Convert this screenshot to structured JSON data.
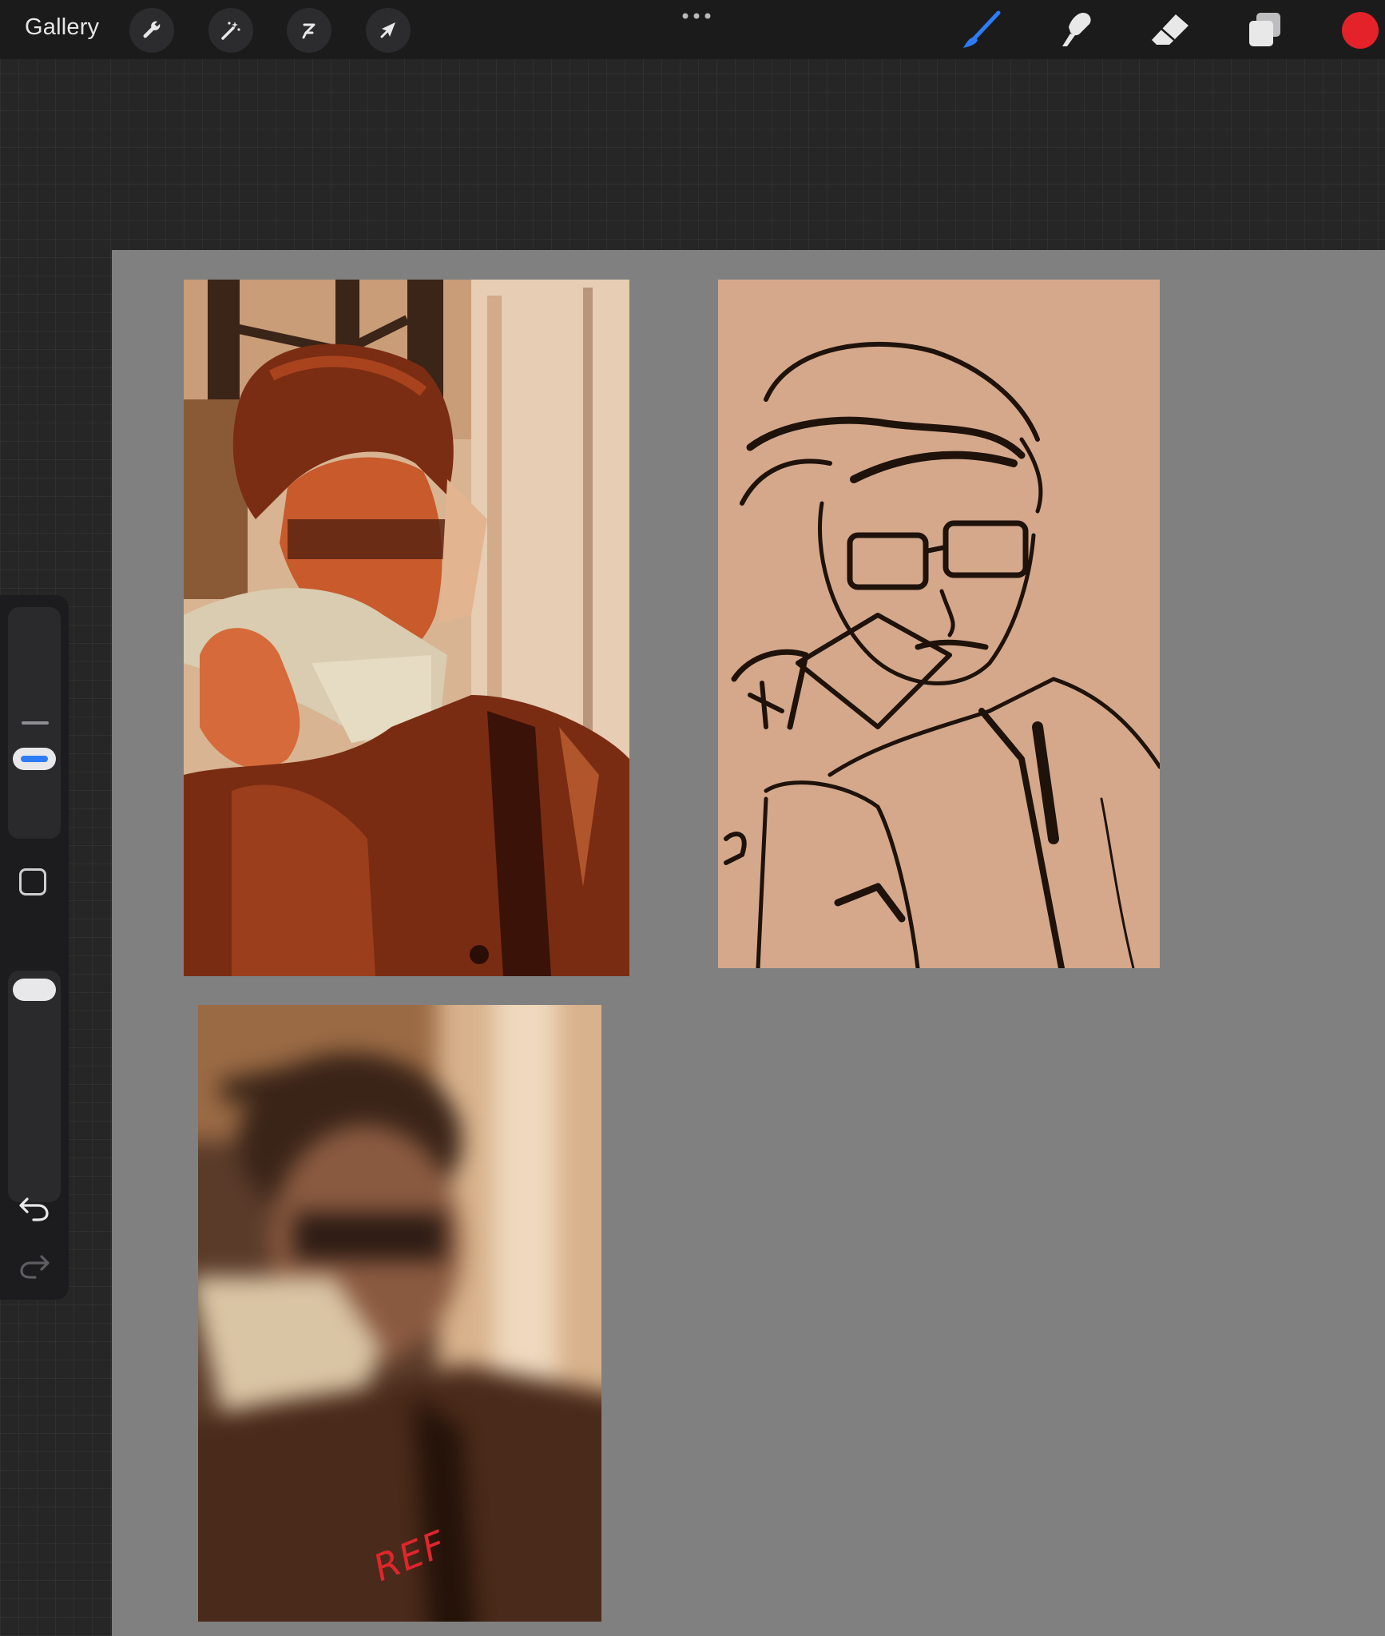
{
  "topbar": {
    "gallery_label": "Gallery",
    "left_tools": [
      "wrench-icon",
      "magic-wand-icon",
      "selection-icon",
      "transform-arrow-icon"
    ],
    "right_tools": [
      "brush-icon",
      "smudge-icon",
      "eraser-icon",
      "layers-icon"
    ],
    "active_tool": "brush",
    "current_color": "#e3222a",
    "accent_color": "#2d7cf6"
  },
  "canvas": {
    "background": "#808080",
    "artworks": [
      {
        "name": "painted-study",
        "description_colors": [
          "#7a2a12",
          "#c4572b",
          "#e0cdb4"
        ]
      },
      {
        "name": "line-sketch",
        "paper": "#d5a88b",
        "ink": "#1e120b"
      },
      {
        "name": "blurred-reference"
      }
    ],
    "ref_label": "REF"
  },
  "sidebar": {
    "brush_size_level": 0.6,
    "opacity_level": 1.0
  }
}
